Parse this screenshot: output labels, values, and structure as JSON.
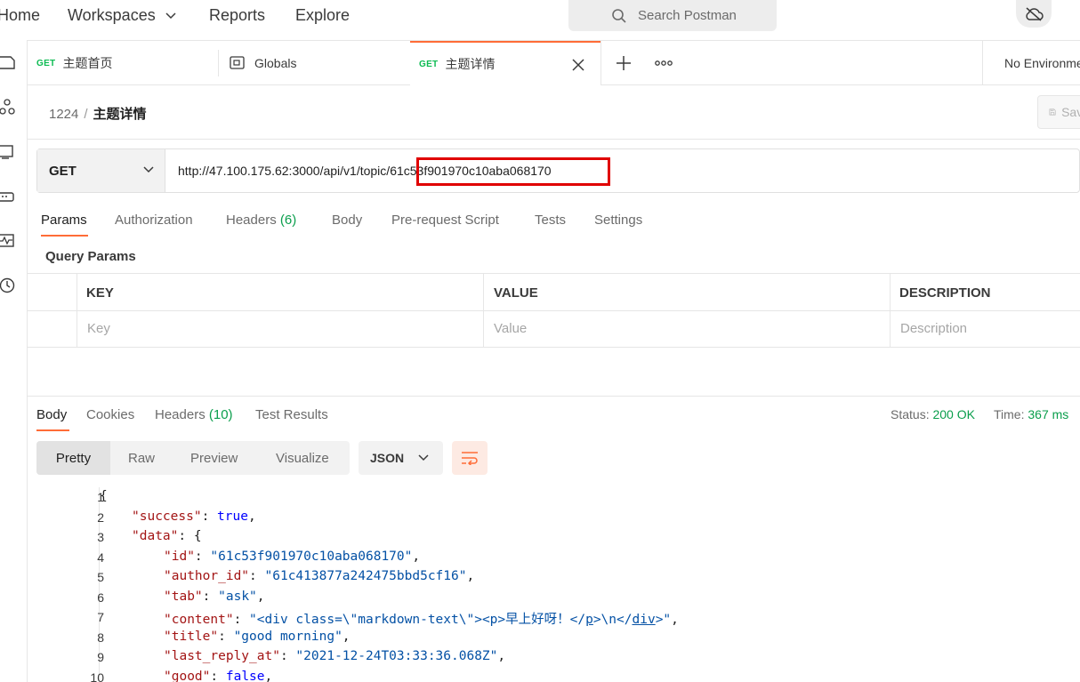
{
  "topbar": {
    "nav": [
      {
        "label": "Home"
      },
      {
        "label": "Workspaces"
      },
      {
        "label": "Reports"
      },
      {
        "label": "Explore"
      }
    ],
    "search_placeholder": "Search Postman"
  },
  "tabs": [
    {
      "method": "GET",
      "title": "主题首页"
    },
    {
      "method": "",
      "title": "Globals"
    },
    {
      "method": "GET",
      "title": "主题详情"
    }
  ],
  "environment": "No Environment",
  "breadcrumb": {
    "collection": "1224",
    "separator": "/",
    "request": "主题详情"
  },
  "save_label": "Save",
  "request": {
    "method": "GET",
    "url_prefix": "http://47.100.175.62:3000/api/v1/topic/",
    "url_id": "61c53f901970c10aba068170"
  },
  "request_tabs": [
    {
      "label": "Params"
    },
    {
      "label": "Authorization"
    },
    {
      "label": "Headers",
      "count": "(6)"
    },
    {
      "label": "Body"
    },
    {
      "label": "Pre-request Script"
    },
    {
      "label": "Tests"
    },
    {
      "label": "Settings"
    }
  ],
  "query_params": {
    "title": "Query Params",
    "columns": [
      "KEY",
      "VALUE",
      "DESCRIPTION"
    ],
    "placeholders": [
      "Key",
      "Value",
      "Description"
    ]
  },
  "response": {
    "tabs": [
      {
        "label": "Body"
      },
      {
        "label": "Cookies"
      },
      {
        "label": "Headers",
        "count": "(10)"
      },
      {
        "label": "Test Results"
      }
    ],
    "status_label": "Status:",
    "status_value": "200 OK",
    "time_label": "Time:",
    "time_value": "367 ms",
    "views": [
      "Pretty",
      "Raw",
      "Preview",
      "Visualize"
    ],
    "format": "JSON"
  },
  "code_lines": [
    {
      "n": "1"
    },
    {
      "n": "2"
    },
    {
      "n": "3"
    },
    {
      "n": "4"
    },
    {
      "n": "5"
    },
    {
      "n": "6"
    },
    {
      "n": "7"
    },
    {
      "n": "8"
    },
    {
      "n": "9"
    },
    {
      "n": "10"
    }
  ],
  "json_body": {
    "success_key": "\"success\"",
    "success_val": "true",
    "data_key": "\"data\"",
    "id_key": "\"id\"",
    "id_val": "\"61c53f901970c10aba068170\"",
    "author_key": "\"author_id\"",
    "author_val": "\"61c413877a242475bbd5cf16\"",
    "tab_key": "\"tab\"",
    "tab_val": "\"ask\"",
    "content_key": "\"content\"",
    "content_val_a": "\"<div class=\\\"markdown-text\\\"><p>早上好呀！</",
    "content_val_b": "p",
    "content_val_c": ">\\n</",
    "content_val_d": "div",
    "content_val_e": ">\"",
    "title_key": "\"title\"",
    "title_val": "\"good morning\"",
    "reply_key": "\"last_reply_at\"",
    "reply_val": "\"2021-12-24T03:33:36.068Z\"",
    "good_key": "\"good\"",
    "good_val": "false"
  }
}
